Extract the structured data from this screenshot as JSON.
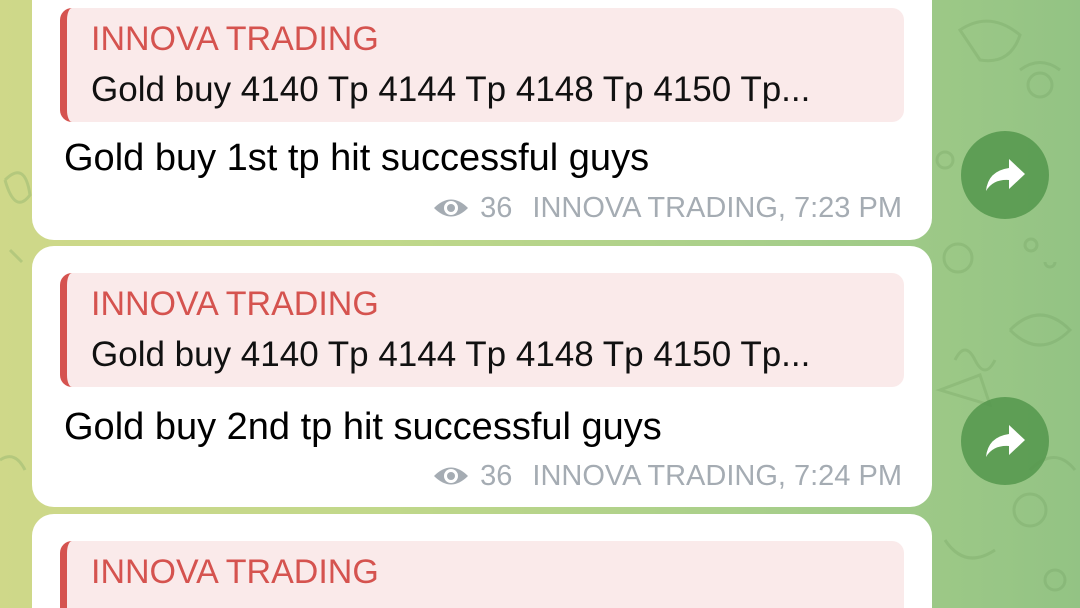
{
  "colors": {
    "accent_red": "#d5534f",
    "reply_bg": "#faeaea",
    "meta_gray": "#a5acb3",
    "forward_green": "#54974c"
  },
  "messages": [
    {
      "reply": {
        "name": "INNOVA TRADING",
        "text": "Gold buy 4140 Tp 4144 Tp 4148 Tp 4150 Tp..."
      },
      "text": "Gold buy 1st tp hit successful guys",
      "views": "36",
      "author_time": "INNOVA TRADING, 7:23 PM",
      "view_icon": "eye-icon",
      "forward_icon": "share-arrow-icon"
    },
    {
      "reply": {
        "name": "INNOVA TRADING",
        "text": "Gold buy 4140 Tp 4144 Tp 4148 Tp 4150 Tp..."
      },
      "text": "Gold buy 2nd tp hit successful guys",
      "views": "36",
      "author_time": "INNOVA TRADING, 7:24 PM",
      "view_icon": "eye-icon",
      "forward_icon": "share-arrow-icon"
    },
    {
      "reply": {
        "name": "INNOVA TRADING"
      }
    }
  ]
}
